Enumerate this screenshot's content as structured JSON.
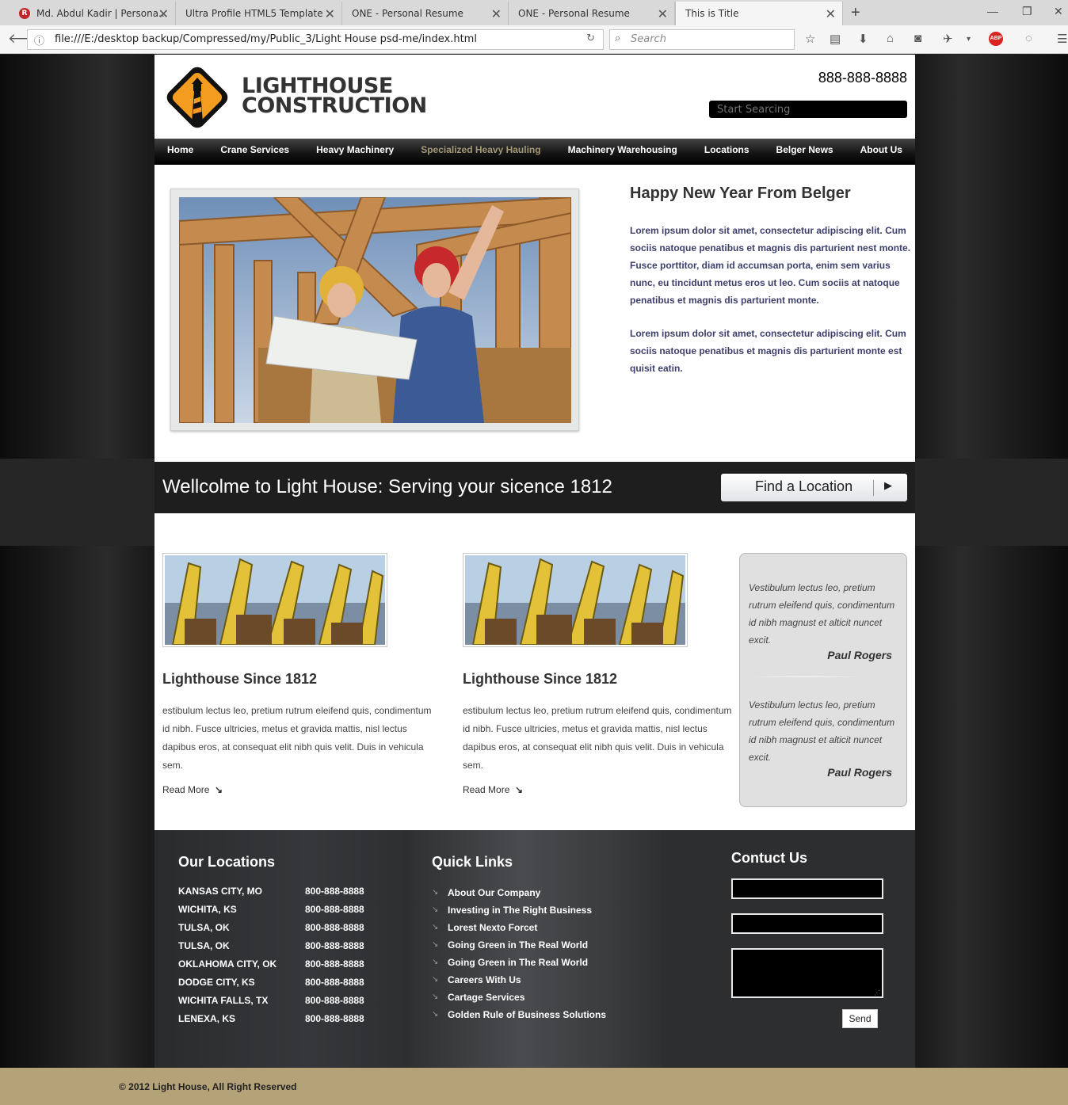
{
  "browser": {
    "tabs": [
      {
        "title": "Md. Abdul Kadir | Persona..."
      },
      {
        "title": "Ultra Profile HTML5 Template"
      },
      {
        "title": "ONE - Personal Resume"
      },
      {
        "title": "ONE - Personal Resume"
      },
      {
        "title": "This is Title"
      }
    ],
    "url": "file:///E:/desktop backup/Compressed/my/Public_3/Light House psd-me/index.html",
    "search_placeholder": "Search"
  },
  "header": {
    "brand_line1": "LIGHTHOUSE",
    "brand_line2": "CONSTRUCTION",
    "phone": "888-888-8888",
    "search_placeholder": "Start Searcing"
  },
  "nav": [
    "Home",
    "Crane Services",
    "Heavy Machinery",
    "Specialized Heavy Hauling",
    "Machinery Warehousing",
    "Locations",
    "Belger News",
    "About Us"
  ],
  "hero": {
    "heading": "Happy New Year From Belger",
    "p1": "Lorem ipsum dolor sit amet, consectetur adipiscing elit. Cum sociis natoque penatibus et magnis dis parturient nest monte. Fusce porttitor, diam id accumsan porta, enim sem varius nunc, eu tincidunt metus eros ut leo. Cum sociis at natoque penatibus et magnis dis parturient monte.",
    "p2": "Lorem ipsum dolor sit amet, consectetur adipiscing elit. Cum sociis natoque penatibus et magnis dis parturient monte est quisit eatin."
  },
  "banner": {
    "text": "Wellcolme to Light House: Serving your sicence 1812",
    "button": "Find a Location"
  },
  "columns": [
    {
      "title": "Lighthouse Since 1812",
      "body": "estibulum lectus leo, pretium rutrum eleifend quis, condimentum id nibh. Fusce ultricies, metus et gravida mattis, nisl lectus dapibus eros, at consequat elit nibh quis velit. Duis in vehicula sem.",
      "more": "Read More"
    },
    {
      "title": "Lighthouse Since 1812",
      "body": "estibulum lectus leo, pretium rutrum eleifend quis, condimentum id nibh. Fusce ultricies, metus et gravida mattis, nisl lectus dapibus eros, at consequat elit nibh quis velit. Duis in vehicula sem.",
      "more": "Read More"
    }
  ],
  "testimonials": [
    {
      "quote": "Vestibulum lectus leo, pretium rutrum eleifend quis, condimentum id nibh magnust et alticit nuncet excit.",
      "author": "Paul Rogers"
    },
    {
      "quote": "Vestibulum lectus leo, pretium rutrum eleifend quis, condimentum id nibh magnust et alticit nuncet excit.",
      "author": "Paul Rogers"
    }
  ],
  "footer": {
    "locations_title": "Our Locations",
    "locations": [
      {
        "city": "KANSAS CITY, MO",
        "phone": "800-888-8888"
      },
      {
        "city": "WICHITA, KS",
        "phone": "800-888-8888"
      },
      {
        "city": "TULSA, OK",
        "phone": "800-888-8888"
      },
      {
        "city": "TULSA, OK",
        "phone": "800-888-8888"
      },
      {
        "city": "OKLAHOMA CITY, OK",
        "phone": "800-888-8888"
      },
      {
        "city": "DODGE CITY, KS",
        "phone": "800-888-8888"
      },
      {
        "city": "WICHITA FALLS, TX",
        "phone": "800-888-8888"
      },
      {
        "city": "LENEXA, KS",
        "phone": "800-888-8888"
      }
    ],
    "links_title": "Quick Links",
    "links": [
      "About Our Company",
      "Investing in The Right Business",
      "Lorest Nexto Forcet",
      "Going Green in The Real World",
      "Going Green in The Real World",
      "Careers With Us",
      "Cartage Services",
      "Golden Rule of Business Solutions"
    ],
    "contact_title": "Contuct Us",
    "send": "Send"
  },
  "copyright": "© 2012 Light House, All Right Reserved",
  "colors": {
    "accent": "#b4a279",
    "nav_active": "#a49877",
    "hero_text": "#3d3f6b"
  }
}
